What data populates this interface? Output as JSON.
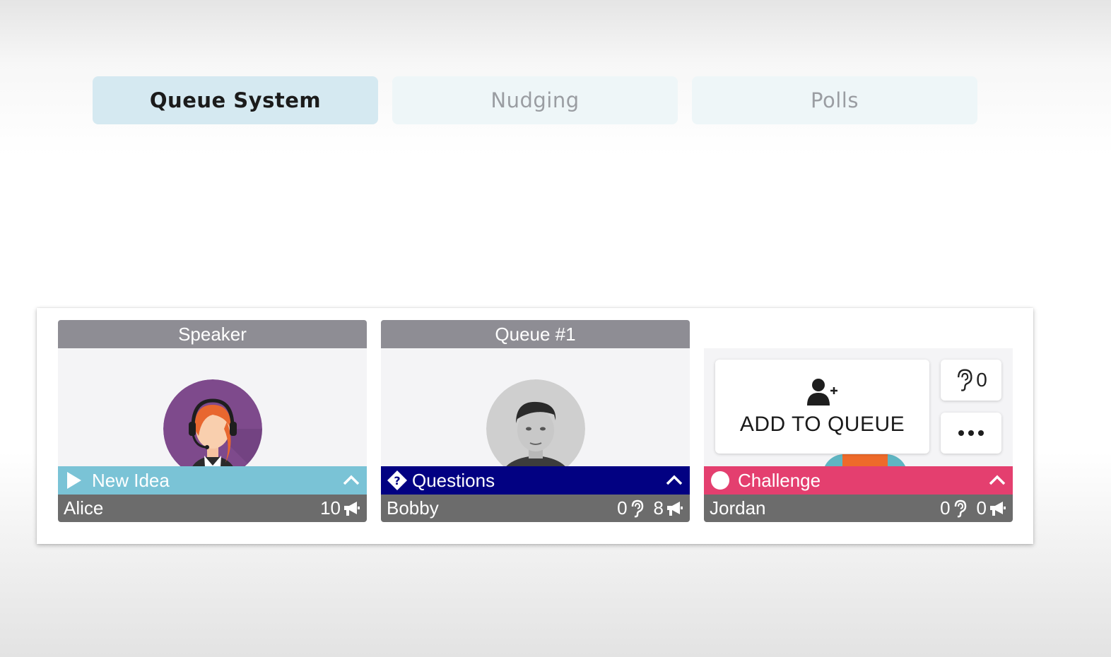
{
  "tabs": [
    {
      "label": "Queue System",
      "active": true
    },
    {
      "label": "Nudging",
      "active": false
    },
    {
      "label": "Polls",
      "active": false
    }
  ],
  "cards": [
    {
      "header": "Speaker",
      "category": "New Idea",
      "category_icon": "play-icon",
      "category_color": "#7ac3d6",
      "name": "Alice",
      "stats": [
        {
          "value": "10",
          "icon": "megaphone-icon"
        }
      ]
    },
    {
      "header": "Queue #1",
      "category": "Questions",
      "category_icon": "question-diamond-icon",
      "category_color": "#020182",
      "name": "Bobby",
      "stats": [
        {
          "value": "0",
          "icon": "ear-icon"
        },
        {
          "value": "8",
          "icon": "megaphone-icon"
        }
      ]
    },
    {
      "header": "",
      "category": "Challenge",
      "category_icon": "circle-icon",
      "category_color": "#e43f6f",
      "name": "Jordan",
      "stats": [
        {
          "value": "0",
          "icon": "ear-icon"
        },
        {
          "value": "0",
          "icon": "megaphone-icon"
        }
      ]
    }
  ],
  "add_queue": {
    "label": "ADD TO QUEUE",
    "icon": "add-user-icon",
    "listen_count": "0",
    "listen_icon": "ear-icon",
    "more_icon": "more-dots-icon"
  },
  "colors": {
    "header_gray": "#8e8d94",
    "name_bar": "#6c6c6c",
    "tab_active": "#d5e9f1",
    "tab_inactive": "#eef6f8"
  }
}
